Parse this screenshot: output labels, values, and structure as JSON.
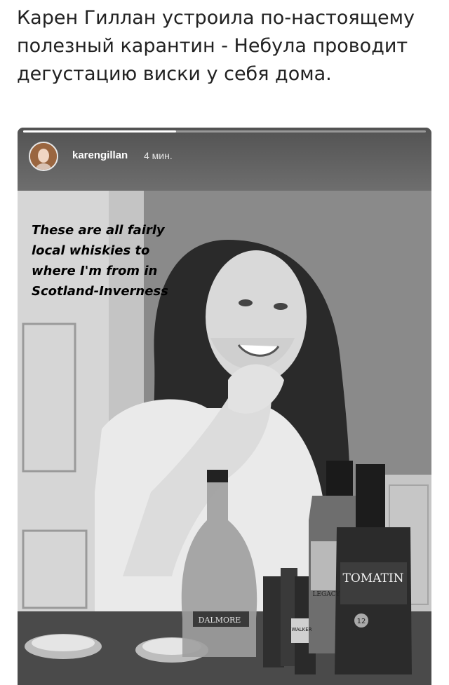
{
  "headline": "Карен Гиллан устроила по-настоящему полезный карантин - Небула проводит дегустацию виски у себя дома.",
  "story": {
    "username": "karengillan",
    "time": "4 мин.",
    "progress": 0.38,
    "caption_lines": [
      "These are all fairly",
      "local whiskies to",
      "where I'm from in",
      "Scotland-Inverness"
    ],
    "bottles": {
      "dalmore": "DALMORE",
      "tomatin": "TOMATIN",
      "tomatin_age": "12",
      "legacy": "LEGACY",
      "walker": "WALKER"
    }
  },
  "colors": {
    "headline_text": "#222222",
    "story_bg": "#7a7a7a",
    "progress_fill": "#ffffff"
  }
}
